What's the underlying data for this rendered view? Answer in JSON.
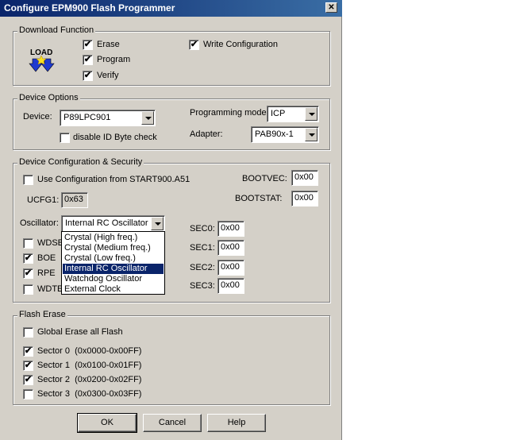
{
  "window": {
    "title": "Configure EPM900 Flash Programmer",
    "close_glyph": "✕"
  },
  "download": {
    "legend": "Download Function",
    "logo_text": "LOAD",
    "erase": {
      "label": "Erase",
      "checked": true
    },
    "program": {
      "label": "Program",
      "checked": true
    },
    "verify": {
      "label": "Verify",
      "checked": true
    },
    "write_config": {
      "label": "Write Configuration",
      "checked": true
    }
  },
  "device_options": {
    "legend": "Device Options",
    "device_label": "Device:",
    "device_value": "P89LPC901",
    "disable_id": {
      "label": "disable ID Byte check",
      "checked": false
    },
    "prog_mode_label": "Programming mode:",
    "prog_mode_value": "ICP",
    "adapter_label": "Adapter:",
    "adapter_value": "PAB90x-1"
  },
  "security": {
    "legend": "Device Configuration & Security",
    "use_config": {
      "label": "Use Configuration from START900.A51",
      "checked": false
    },
    "bootvec_label": "BOOTVEC:",
    "bootvec_value": "0x00",
    "bootstat_label": "BOOTSTAT:",
    "bootstat_value": "0x00",
    "ucfg1_label": "UCFG1:",
    "ucfg1_value": "0x63",
    "osc_label": "Oscillator:",
    "osc_value": "Internal RC Oscillator",
    "wdse": {
      "label": "WDSE",
      "checked": false
    },
    "boe": {
      "label": "BOE",
      "checked": true
    },
    "rpe": {
      "label": "RPE",
      "checked": true
    },
    "wdte": {
      "label": "WDTE",
      "checked": false
    },
    "sec0_label": "SEC0:",
    "sec0_value": "0x00",
    "sec1_label": "SEC1:",
    "sec1_value": "0x00",
    "sec2_label": "SEC2:",
    "sec2_value": "0x00",
    "sec3_label": "SEC3:",
    "sec3_value": "0x00",
    "osc_options": [
      "Crystal (High freq.)",
      "Crystal (Medium freq.)",
      "Crystal (Low freq.)",
      "Internal RC Oscillator",
      "Watchdog Oscillator",
      "External Clock"
    ],
    "osc_selected_index": 3
  },
  "flash_erase": {
    "legend": "Flash Erase",
    "global": {
      "label": "Global Erase all Flash",
      "checked": false
    },
    "sectors": [
      {
        "label": "Sector 0  (0x0000-0x00FF)",
        "checked": true
      },
      {
        "label": "Sector 1  (0x0100-0x01FF)",
        "checked": true
      },
      {
        "label": "Sector 2  (0x0200-0x02FF)",
        "checked": true
      },
      {
        "label": "Sector 3  (0x0300-0x03FF)",
        "checked": false
      }
    ]
  },
  "buttons": {
    "ok": "OK",
    "cancel": "Cancel",
    "help": "Help"
  },
  "colors": {
    "title_start": "#0a246a",
    "title_end": "#3a6ea5",
    "face": "#d4d0c8",
    "logo_arrow": "#1f3ad0",
    "logo_star": "#f8e020"
  }
}
